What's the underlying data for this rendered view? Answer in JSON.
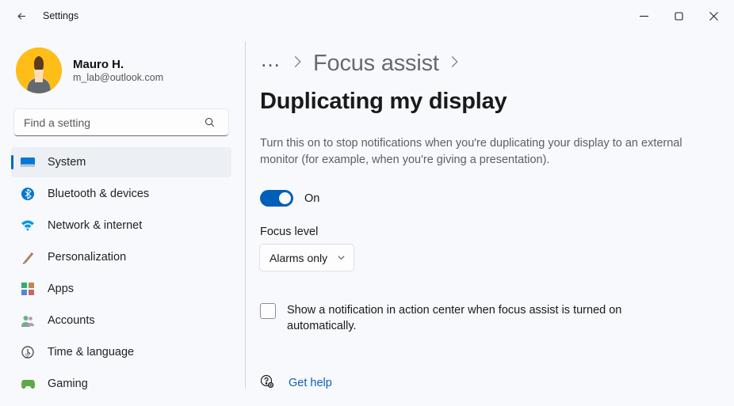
{
  "window": {
    "title": "Settings"
  },
  "profile": {
    "name": "Mauro H.",
    "email": "m_lab@outlook.com"
  },
  "search": {
    "placeholder": "Find a setting"
  },
  "nav": {
    "items": [
      {
        "label": "System"
      },
      {
        "label": "Bluetooth & devices"
      },
      {
        "label": "Network & internet"
      },
      {
        "label": "Personalization"
      },
      {
        "label": "Apps"
      },
      {
        "label": "Accounts"
      },
      {
        "label": "Time & language"
      },
      {
        "label": "Gaming"
      }
    ]
  },
  "breadcrumb": {
    "parent": "Focus assist",
    "current": "Duplicating my display"
  },
  "main": {
    "description": "Turn this on to stop notifications when you're duplicating your display to an external monitor (for example, when you're giving a presentation).",
    "toggle_label": "On",
    "focus_level_label": "Focus level",
    "focus_level_value": "Alarms only",
    "checkbox_text": "Show a notification in action center when focus assist is turned on automatically.",
    "help_label": "Get help"
  }
}
